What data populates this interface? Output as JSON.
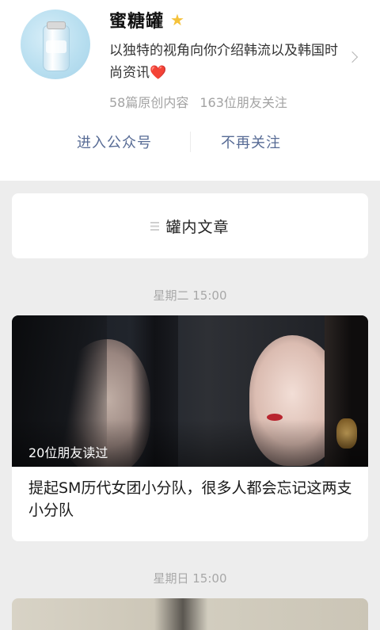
{
  "account": {
    "name": "蜜糖罐",
    "description": "以独特的视角向你介绍韩流以及韩国时尚资讯",
    "heart": "❤️",
    "original_count": "58篇原创内容",
    "friends_following": "163位朋友关注"
  },
  "actions": {
    "enter_label": "进入公众号",
    "unfollow_label": "不再关注"
  },
  "articles_entry": {
    "label": "罐内文章"
  },
  "feed": [
    {
      "time": "星期二 15:00",
      "read_by": "20位朋友读过",
      "title": "提起SM历代女团小分队，很多人都会忘记这两支小分队"
    },
    {
      "time": "星期日 15:00"
    }
  ],
  "colors": {
    "link": "#576b95",
    "star": "#f5c23a",
    "background": "#ededed"
  },
  "icons": {
    "star": "star-icon",
    "chevron": "chevron-right-icon",
    "list": "list-icon"
  }
}
